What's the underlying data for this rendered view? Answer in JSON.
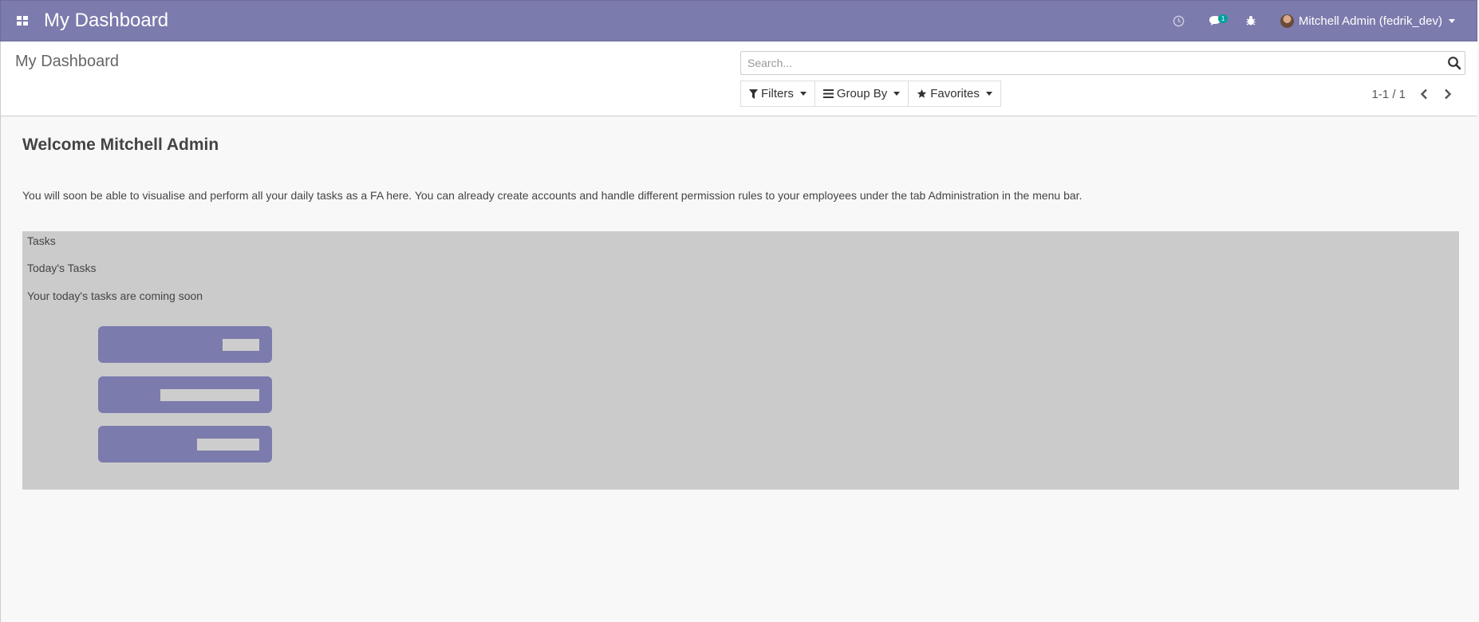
{
  "navbar": {
    "brand": "My Dashboard",
    "chat_badge": "1",
    "user": "Mitchell Admin (fedrik_dev)"
  },
  "control_panel": {
    "title": "My Dashboard",
    "search_placeholder": "Search...",
    "filters_label": "Filters",
    "groupby_label": "Group By",
    "favorites_label": "Favorites",
    "pager": "1-1 / 1"
  },
  "content": {
    "welcome": "Welcome Mitchell Admin",
    "intro": "You will soon be able to visualise and perform all your daily tasks as a FA here. You can already create accounts and handle different permission rules to your employees under the tab Administration in the menu bar.",
    "tasks_panel": {
      "heading": "Tasks",
      "subheading": "Today's Tasks",
      "message": "Your today's tasks are coming soon"
    }
  },
  "colors": {
    "brand": "#7c7bad",
    "badge": "#00a09d",
    "panel": "#cbcbcb"
  }
}
